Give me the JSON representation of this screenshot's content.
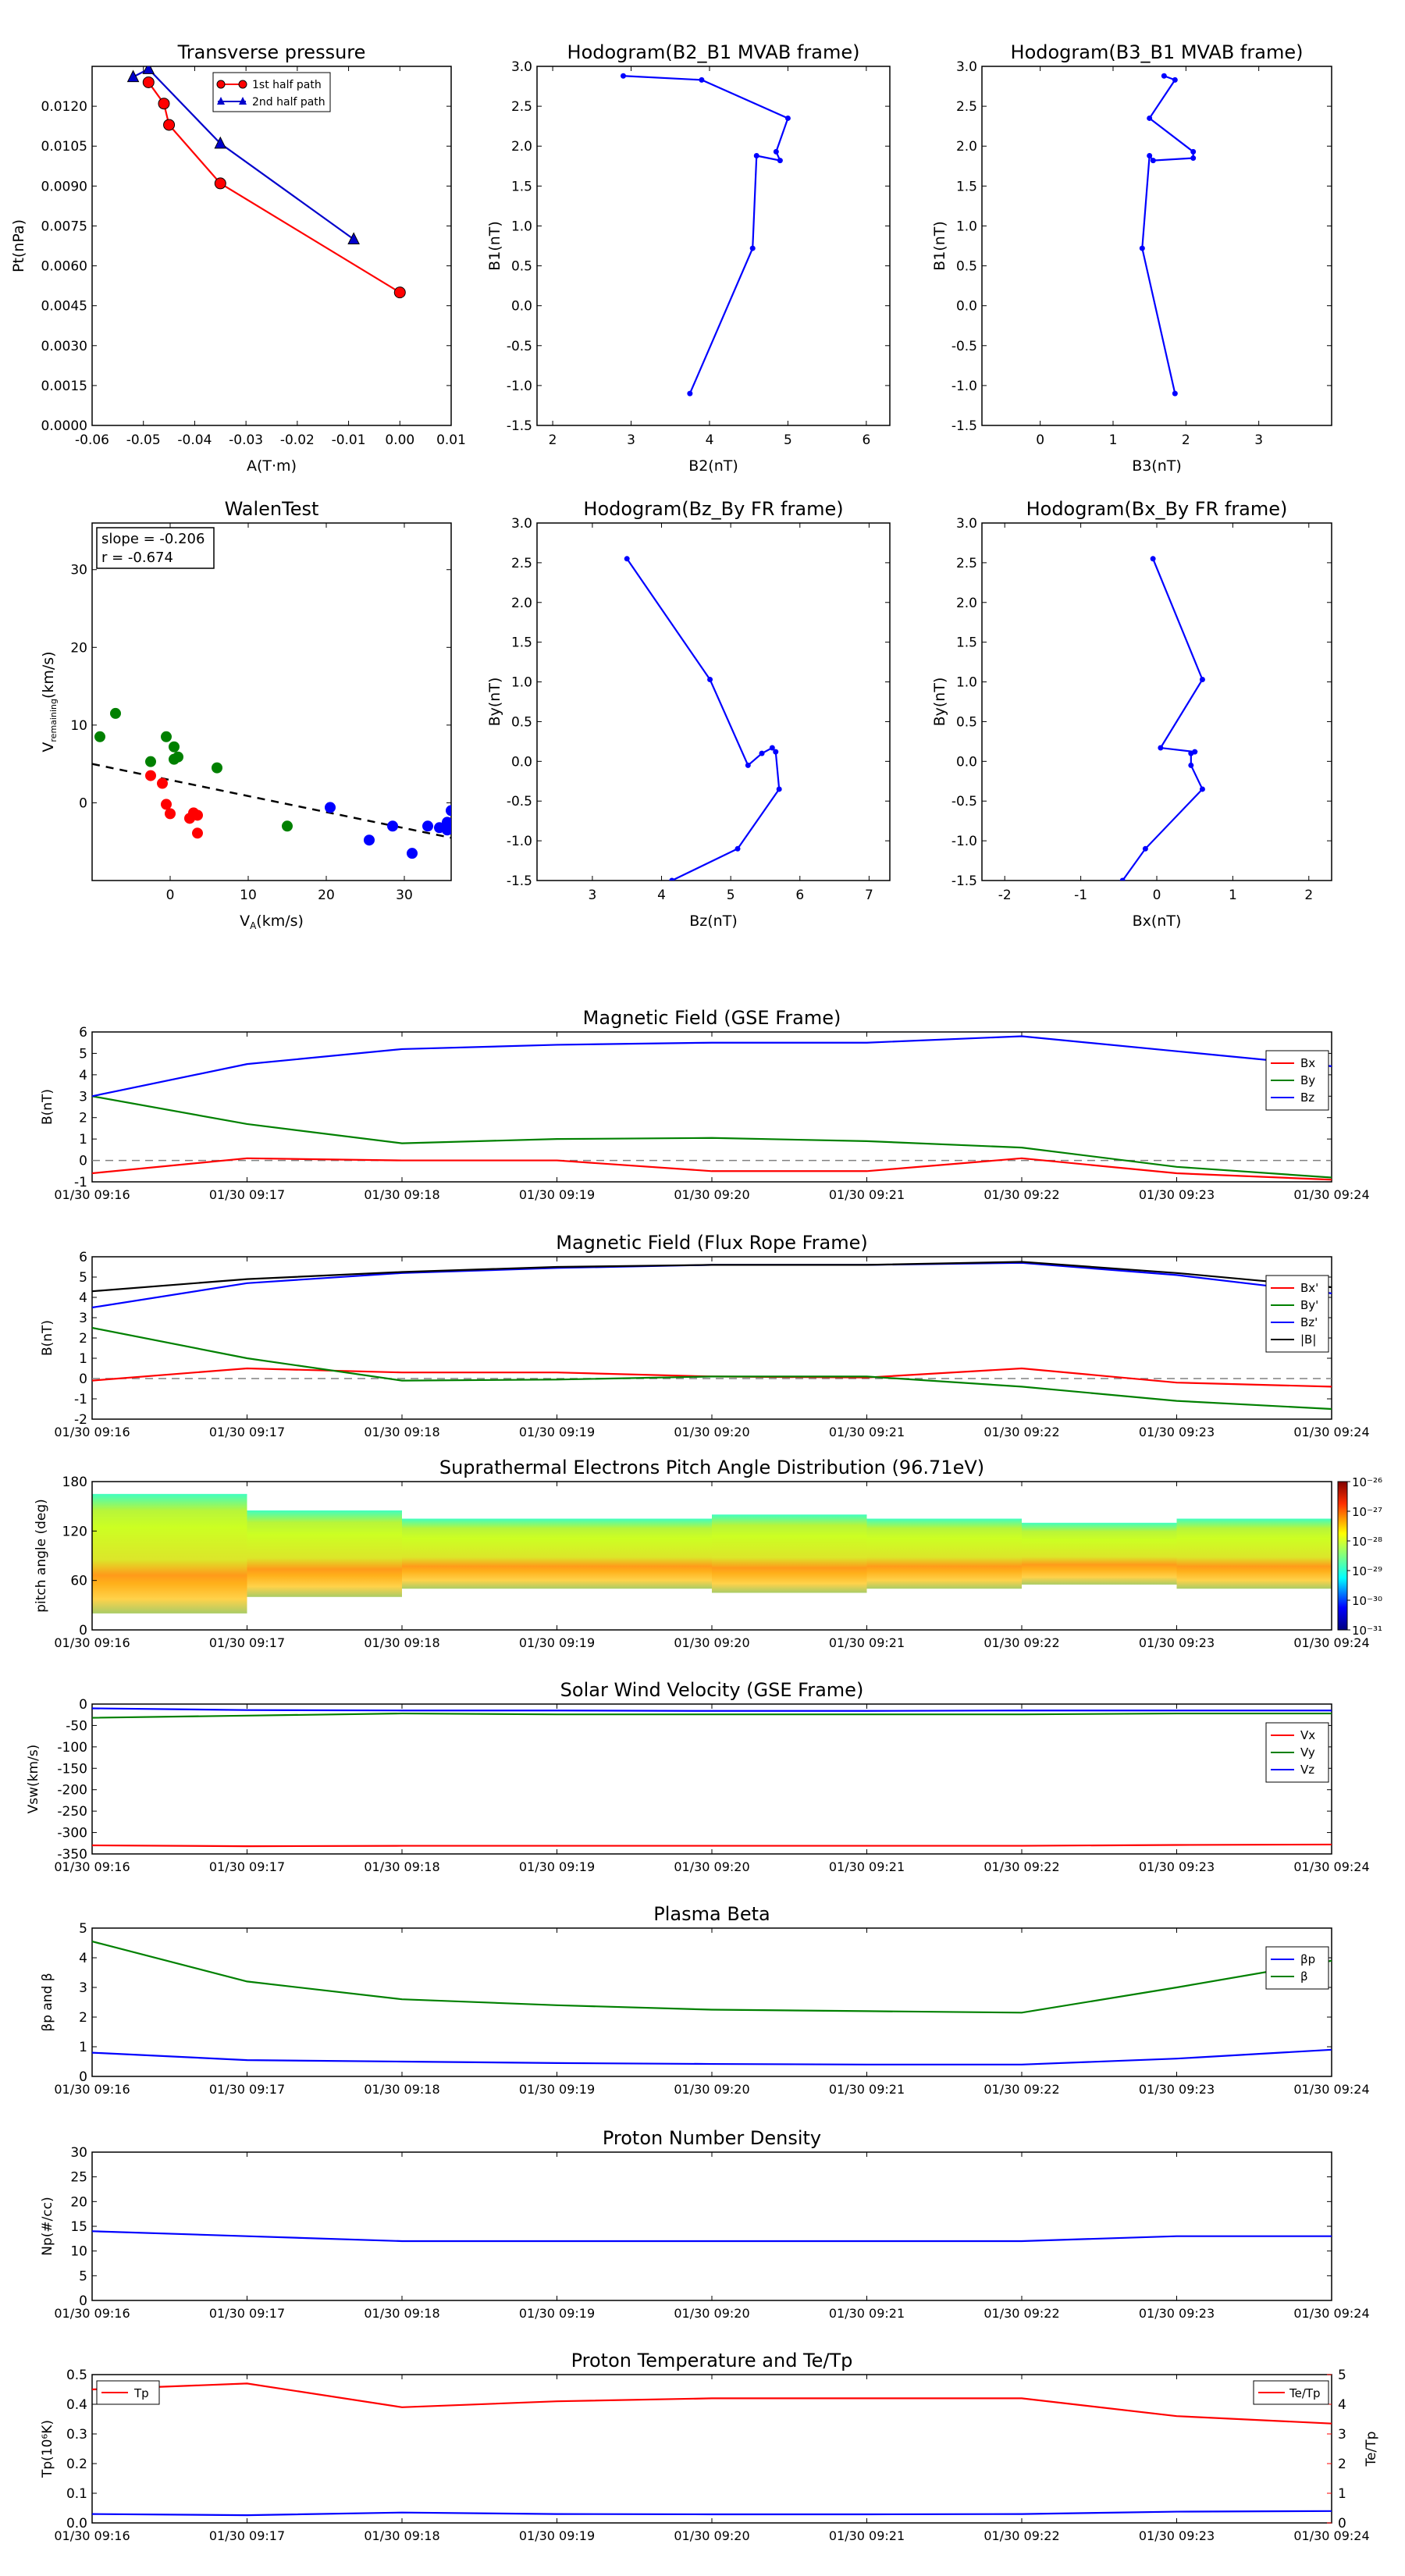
{
  "times": [
    "01/30 09:16",
    "01/30 09:17",
    "01/30 09:18",
    "01/30 09:19",
    "01/30 09:20",
    "01/30 09:21",
    "01/30 09:22",
    "01/30 09:23",
    "01/30 09:24"
  ],
  "colors": {
    "red": "#ff0000",
    "green": "#008000",
    "blue": "#0000ff",
    "black": "#000000",
    "dashed": "#808080"
  },
  "chart_data": [
    {
      "type": "line",
      "title": "Transverse pressure",
      "xlabel": "A(T·m)",
      "ylabel": "Pt(nPa)",
      "xlim": [
        -0.06,
        0.01
      ],
      "ylim": [
        0,
        0.0135
      ],
      "xticks": [
        -0.06,
        -0.05,
        -0.04,
        -0.03,
        -0.02,
        -0.01,
        0.0,
        0.01
      ],
      "yticks": [
        0.0,
        0.0015,
        0.003,
        0.0045,
        0.006,
        0.0075,
        0.009,
        0.0105,
        0.012
      ],
      "legend": "top-right",
      "series": [
        {
          "name": "1st half path",
          "marker": "circle",
          "color": "#ff0000",
          "x": [
            -0.049,
            -0.046,
            -0.045,
            -0.035,
            0.0
          ],
          "y": [
            0.0129,
            0.0121,
            0.0113,
            0.0091,
            0.005
          ]
        },
        {
          "name": "2nd half path",
          "marker": "triangle",
          "color": "#0000cc",
          "x": [
            -0.052,
            -0.049,
            -0.035,
            -0.009
          ],
          "y": [
            0.0131,
            0.0134,
            0.0106,
            0.007
          ]
        }
      ]
    },
    {
      "type": "line",
      "title": "Hodogram(B2_B1 MVAB frame)",
      "xlabel": "B2(nT)",
      "ylabel": "B1(nT)",
      "xlim": [
        1.8,
        6.3
      ],
      "ylim": [
        -1.5,
        3.0
      ],
      "xticks": [
        2,
        3,
        4,
        5,
        6
      ],
      "yticks": [
        -1.5,
        -1.0,
        -0.5,
        0.0,
        0.5,
        1.0,
        1.5,
        2.0,
        2.5,
        3.0
      ],
      "series": [
        {
          "color": "#0000ff",
          "x": [
            2.9,
            3.9,
            5.0,
            4.85,
            4.9,
            4.6,
            4.55,
            3.75
          ],
          "y": [
            2.88,
            2.83,
            2.35,
            1.93,
            1.82,
            1.88,
            0.72,
            -1.1
          ]
        }
      ]
    },
    {
      "type": "line",
      "title": "Hodogram(B3_B1 MVAB frame)",
      "xlabel": "B3(nT)",
      "ylabel": "B1(nT)",
      "xlim": [
        -0.8,
        4.0
      ],
      "ylim": [
        -1.5,
        3.0
      ],
      "xticks": [
        0,
        1,
        2,
        3
      ],
      "yticks": [
        -1.5,
        -1.0,
        -0.5,
        0.0,
        0.5,
        1.0,
        1.5,
        2.0,
        2.5,
        3.0
      ],
      "series": [
        {
          "color": "#0000ff",
          "x": [
            1.7,
            1.85,
            1.5,
            2.1,
            2.1,
            1.55,
            1.5,
            1.4,
            1.85
          ],
          "y": [
            2.88,
            2.83,
            2.35,
            1.93,
            1.85,
            1.82,
            1.88,
            0.72,
            -1.1
          ]
        }
      ]
    },
    {
      "type": "scatter",
      "title": "WalenTest",
      "xlabel": "V_A(km/s)",
      "ylabel": "V_remaining(km/s)",
      "xlim": [
        -10,
        36
      ],
      "ylim": [
        -10,
        36
      ],
      "xticks": [
        0,
        10,
        20,
        30
      ],
      "yticks": [
        0,
        10,
        20,
        30
      ],
      "annotation": [
        "slope = -0.206",
        "r = -0.674"
      ],
      "fit": {
        "slope": -0.206,
        "x": [
          -10,
          36
        ],
        "y": [
          5.0,
          -4.5
        ]
      },
      "series": [
        {
          "color": "#008000",
          "x": [
            -9,
            -7,
            -2.5,
            -0.5,
            0.5,
            0.5,
            1.0,
            6.0,
            15.0
          ],
          "y": [
            8.5,
            11.5,
            5.3,
            8.5,
            7.2,
            5.6,
            5.9,
            4.5,
            -3.0
          ]
        },
        {
          "color": "#ff0000",
          "x": [
            -2.5,
            -1,
            -0.5,
            0,
            2.5,
            3,
            3.5,
            3.5
          ],
          "y": [
            3.5,
            2.5,
            -0.2,
            -1.4,
            -2.0,
            -1.3,
            -1.6,
            -3.9
          ]
        },
        {
          "color": "#0000ff",
          "x": [
            20.5,
            25.5,
            28.5,
            31,
            33,
            34.5,
            35.5,
            35.5,
            36
          ],
          "y": [
            -0.6,
            -4.8,
            -3.0,
            -6.5,
            -3.0,
            -3.2,
            -3.5,
            -2.5,
            -1.0
          ]
        }
      ]
    },
    {
      "type": "line",
      "title": "Hodogram(Bz_By FR frame)",
      "xlabel": "Bz(nT)",
      "ylabel": "By(nT)",
      "xlim": [
        2.2,
        7.3
      ],
      "ylim": [
        -1.5,
        3.0
      ],
      "xticks": [
        3,
        4,
        5,
        6,
        7
      ],
      "yticks": [
        -1.5,
        -1.0,
        -0.5,
        0.0,
        0.5,
        1.0,
        1.5,
        2.0,
        2.5,
        3.0
      ],
      "series": [
        {
          "color": "#0000ff",
          "x": [
            3.5,
            4.7,
            5.25,
            5.45,
            5.6,
            5.65,
            5.7,
            5.1,
            4.15
          ],
          "y": [
            2.55,
            1.03,
            -0.05,
            0.1,
            0.17,
            0.12,
            -0.35,
            -1.1,
            -1.5
          ]
        }
      ]
    },
    {
      "type": "line",
      "title": "Hodogram(Bx_By FR frame)",
      "xlabel": "Bx(nT)",
      "ylabel": "By(nT)",
      "xlim": [
        -2.3,
        2.3
      ],
      "ylim": [
        -1.5,
        3.0
      ],
      "xticks": [
        -2,
        -1,
        0,
        1,
        2
      ],
      "yticks": [
        -1.5,
        -1.0,
        -0.5,
        0.0,
        0.5,
        1.0,
        1.5,
        2.0,
        2.5,
        3.0
      ],
      "series": [
        {
          "color": "#0000ff",
          "x": [
            -0.05,
            0.6,
            0.05,
            0.5,
            0.45,
            0.45,
            0.6,
            -0.15,
            -0.45
          ],
          "y": [
            2.55,
            1.03,
            0.17,
            0.12,
            0.1,
            -0.05,
            -0.35,
            -1.1,
            -1.5
          ]
        }
      ]
    },
    {
      "type": "line",
      "title": "Magnetic Field (GSE Frame)",
      "xlabel": "",
      "ylabel": "B(nT)",
      "ylim": [
        -1,
        6
      ],
      "yticks": [
        -1,
        0,
        1,
        2,
        3,
        4,
        5,
        6
      ],
      "hline": 0,
      "legend": "top-right",
      "series": [
        {
          "name": "Bx",
          "color": "#ff0000",
          "y": [
            -0.6,
            0.1,
            0.0,
            0.0,
            -0.5,
            -0.5,
            0.1,
            -0.6,
            -0.9
          ]
        },
        {
          "name": "By",
          "color": "#008000",
          "y": [
            3.0,
            1.7,
            0.8,
            1.0,
            1.05,
            0.9,
            0.6,
            -0.3,
            -0.8
          ]
        },
        {
          "name": "Bz",
          "color": "#0000ff",
          "y": [
            3.0,
            4.5,
            5.2,
            5.4,
            5.5,
            5.5,
            5.8,
            5.1,
            4.4
          ]
        }
      ]
    },
    {
      "type": "line",
      "title": "Magnetic Field (Flux Rope Frame)",
      "xlabel": "",
      "ylabel": "B(nT)",
      "ylim": [
        -2,
        6
      ],
      "yticks": [
        -2,
        -1,
        0,
        1,
        2,
        3,
        4,
        5,
        6
      ],
      "hline": 0,
      "legend": "top-right",
      "series": [
        {
          "name": "Bx'",
          "color": "#ff0000",
          "y": [
            -0.1,
            0.5,
            0.3,
            0.3,
            0.1,
            0.05,
            0.5,
            -0.2,
            -0.4
          ]
        },
        {
          "name": "By'",
          "color": "#008000",
          "y": [
            2.5,
            1.0,
            -0.1,
            -0.05,
            0.1,
            0.1,
            -0.4,
            -1.1,
            -1.5
          ]
        },
        {
          "name": "Bz'",
          "color": "#0000ff",
          "y": [
            3.5,
            4.7,
            5.2,
            5.45,
            5.6,
            5.6,
            5.7,
            5.1,
            4.2
          ]
        },
        {
          "name": "|B|",
          "color": "#000000",
          "y": [
            4.3,
            4.9,
            5.25,
            5.5,
            5.6,
            5.6,
            5.75,
            5.2,
            4.5
          ]
        }
      ]
    },
    {
      "type": "heatmap",
      "title": "Suprathermal Electrons Pitch Angle Distribution (96.71eV)",
      "xlabel": "",
      "ylabel": "pitch angle (deg)",
      "ylim": [
        0,
        180
      ],
      "yticks": [
        0,
        60,
        120,
        180
      ],
      "colorbar_labels": [
        "10⁻²⁶",
        "10⁻²⁷",
        "10⁻²⁸",
        "10⁻²⁹",
        "10⁻³⁰",
        "10⁻³¹"
      ],
      "columns": [
        {
          "lo": 20,
          "hi": 165
        },
        {
          "lo": 40,
          "hi": 145
        },
        {
          "lo": 50,
          "hi": 135
        },
        {
          "lo": 50,
          "hi": 135
        },
        {
          "lo": 45,
          "hi": 140
        },
        {
          "lo": 50,
          "hi": 135
        },
        {
          "lo": 55,
          "hi": 130
        },
        {
          "lo": 50,
          "hi": 135
        }
      ]
    },
    {
      "type": "line",
      "title": "Solar Wind Velocity (GSE Frame)",
      "xlabel": "",
      "ylabel": "Vsw(km/s)",
      "ylim": [
        -350,
        0
      ],
      "yticks": [
        -350,
        -300,
        -250,
        -200,
        -150,
        -100,
        -50,
        0
      ],
      "legend": "top-right",
      "series": [
        {
          "name": "Vx",
          "color": "#ff0000",
          "y": [
            -330,
            -332,
            -331,
            -331,
            -331,
            -331,
            -331,
            -329,
            -328
          ]
        },
        {
          "name": "Vy",
          "color": "#008000",
          "y": [
            -32,
            -27,
            -22,
            -24,
            -24,
            -24,
            -24,
            -22,
            -22
          ]
        },
        {
          "name": "Vz",
          "color": "#0000ff",
          "y": [
            -10,
            -14,
            -15,
            -15,
            -16,
            -16,
            -15,
            -15,
            -15
          ]
        }
      ]
    },
    {
      "type": "line",
      "title": "Plasma Beta",
      "xlabel": "",
      "ylabel": "βp and β",
      "ylim": [
        0,
        5
      ],
      "yticks": [
        0,
        1,
        2,
        3,
        4,
        5
      ],
      "legend": "top-right",
      "series": [
        {
          "name": "βp",
          "color": "#0000ff",
          "y": [
            0.8,
            0.55,
            0.5,
            0.45,
            0.42,
            0.4,
            0.4,
            0.6,
            0.9
          ]
        },
        {
          "name": "β",
          "color": "#008000",
          "y": [
            4.55,
            3.2,
            2.6,
            2.4,
            2.25,
            2.2,
            2.15,
            3.0,
            3.9
          ]
        }
      ]
    },
    {
      "type": "line",
      "title": "Proton Number Density",
      "xlabel": "",
      "ylabel": "Np(#/cc)",
      "ylim": [
        0,
        30
      ],
      "yticks": [
        0,
        5,
        10,
        15,
        20,
        25,
        30
      ],
      "series": [
        {
          "color": "#0000ff",
          "y": [
            14,
            13,
            12,
            12,
            12,
            12,
            12,
            13,
            13
          ]
        }
      ]
    },
    {
      "type": "line",
      "title": "Proton Temperature and Te/Tp",
      "xlabel": "",
      "ylabel": "Tp(10⁶K)",
      "y2label": "Te/Tp",
      "ylim": [
        0,
        0.5
      ],
      "yticks": [
        0.0,
        0.1,
        0.2,
        0.3,
        0.4,
        0.5
      ],
      "y2lim": [
        0,
        5
      ],
      "y2ticks": [
        0,
        1,
        2,
        3,
        4,
        5
      ],
      "legend_left": "Tp",
      "legend_right": "Te/Tp",
      "series": [
        {
          "name": "Tp",
          "color": "#0000ff",
          "y": [
            0.03,
            0.026,
            0.035,
            0.03,
            0.029,
            0.029,
            0.03,
            0.038,
            0.04
          ]
        },
        {
          "name": "Te/Tp",
          "color": "#ff0000",
          "axis": "right",
          "y": [
            4.5,
            4.7,
            3.9,
            4.1,
            4.2,
            4.2,
            4.2,
            3.6,
            3.35
          ]
        }
      ]
    }
  ]
}
